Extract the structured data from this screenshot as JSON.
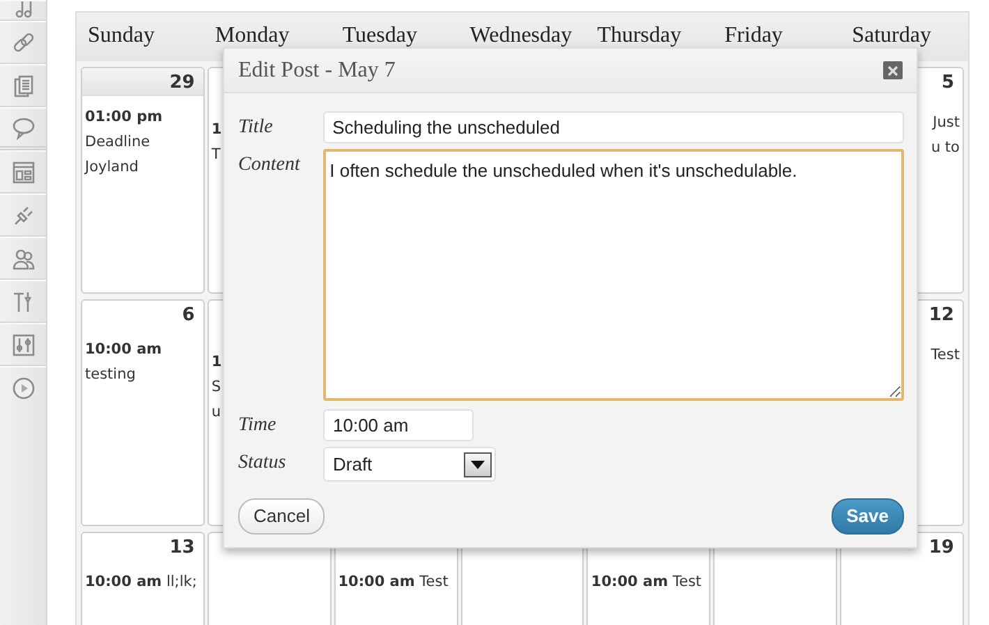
{
  "calendar": {
    "weekdays": [
      "Sunday",
      "Monday",
      "Tuesday",
      "Wednesday",
      "Thursday",
      "Friday",
      "Saturday"
    ],
    "weeks": [
      {
        "days": {
          "sunday": {
            "date": "29",
            "shaded": true,
            "events": [
              {
                "time": "01:00 pm",
                "title": "Deadline Joyland"
              }
            ]
          },
          "monday": {
            "fragments": [
              {
                "text": "1",
                "bold": true
              },
              {
                "text": "T",
                "bold": false
              }
            ]
          },
          "saturday": {
            "date": "5",
            "fragments": [
              {
                "text": "Just",
                "bold": false
              },
              {
                "text": "u to",
                "bold": false
              }
            ]
          }
        }
      },
      {
        "days": {
          "sunday": {
            "date": "6",
            "shaded": false,
            "events": [
              {
                "time": "10:00 am",
                "title": "testing"
              }
            ]
          },
          "monday": {
            "fragments": [
              {
                "text": "1",
                "bold": true
              },
              {
                "text": "S",
                "bold": false
              },
              {
                "text": "u",
                "bold": false
              }
            ]
          },
          "saturday": {
            "date": "12",
            "fragments": [
              {
                "text": "Test",
                "bold": false
              }
            ]
          }
        }
      },
      {
        "days": {
          "sunday": {
            "date": "13",
            "shaded": false,
            "events": [
              {
                "time": "10:00 am",
                "title": "ll;lk;"
              }
            ]
          },
          "monday": {
            "covered": true
          },
          "tuesday": {
            "events": [
              {
                "time": "10:00 am",
                "title": "Test"
              }
            ]
          },
          "wednesday": {
            "covered": true
          },
          "thursday": {
            "events": [
              {
                "time": "10:00 am",
                "title": "Test"
              }
            ]
          },
          "friday": {
            "covered": true
          },
          "saturday": {
            "date": "19"
          }
        }
      }
    ]
  },
  "dialog": {
    "title": "Edit Post - May 7",
    "fields": [
      {
        "kind": "text",
        "label": "Title",
        "value": "Scheduling the unscheduled"
      },
      {
        "kind": "textarea",
        "label": "Content",
        "value": "I often schedule the unscheduled when it's unschedulable.",
        "focused": true
      },
      {
        "kind": "time",
        "label": "Time",
        "value": "10:00 am"
      },
      {
        "kind": "select",
        "label": "Status",
        "value": "Draft"
      }
    ],
    "buttons": [
      {
        "kind": "cancel",
        "label": "Cancel"
      },
      {
        "kind": "save",
        "label": "Save"
      }
    ]
  }
}
